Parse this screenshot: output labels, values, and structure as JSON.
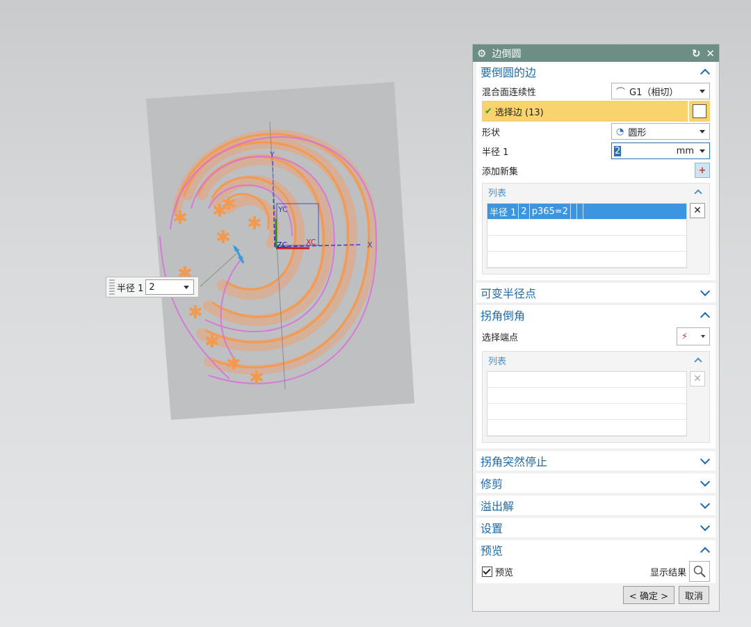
{
  "viewport": {
    "float_label": "半径 1",
    "float_value": "2",
    "axes": {
      "x": "X",
      "y": "Y",
      "xc": "XC",
      "yc": "YC",
      "zc": "ZC"
    }
  },
  "dialog": {
    "title": "边倒圆",
    "groups": {
      "edges": {
        "title": "要倒圆的边",
        "blend_label": "混合面连续性",
        "blend_value": "G1（相切）",
        "select_label": "选择边 (13)",
        "shape_label": "形状",
        "shape_value": "圆形",
        "radius_label": "半径 1",
        "radius_value": "2",
        "radius_unit": "mm",
        "add_new_set": "添加新集",
        "list_title": "列表",
        "list_row": [
          "半径 1",
          "2",
          "p365=2"
        ]
      },
      "variable": {
        "title": "可变半径点"
      },
      "corner": {
        "title": "拐角倒角",
        "select_endpoint": "选择端点",
        "list_title": "列表"
      },
      "corner_stop": {
        "title": "拐角突然停止"
      },
      "trim": {
        "title": "修剪"
      },
      "overflow": {
        "title": "溢出解"
      },
      "settings": {
        "title": "设置"
      },
      "preview": {
        "title": "预览",
        "checkbox_label": "预览",
        "show_result": "显示结果"
      }
    },
    "ok": "< 确定 >",
    "cancel": "取消"
  },
  "colors": {
    "title_bar": "#6d8e85",
    "group_title": "#1f6aa5",
    "selection": "#f9d46e",
    "list_selected": "#3c95e0"
  }
}
